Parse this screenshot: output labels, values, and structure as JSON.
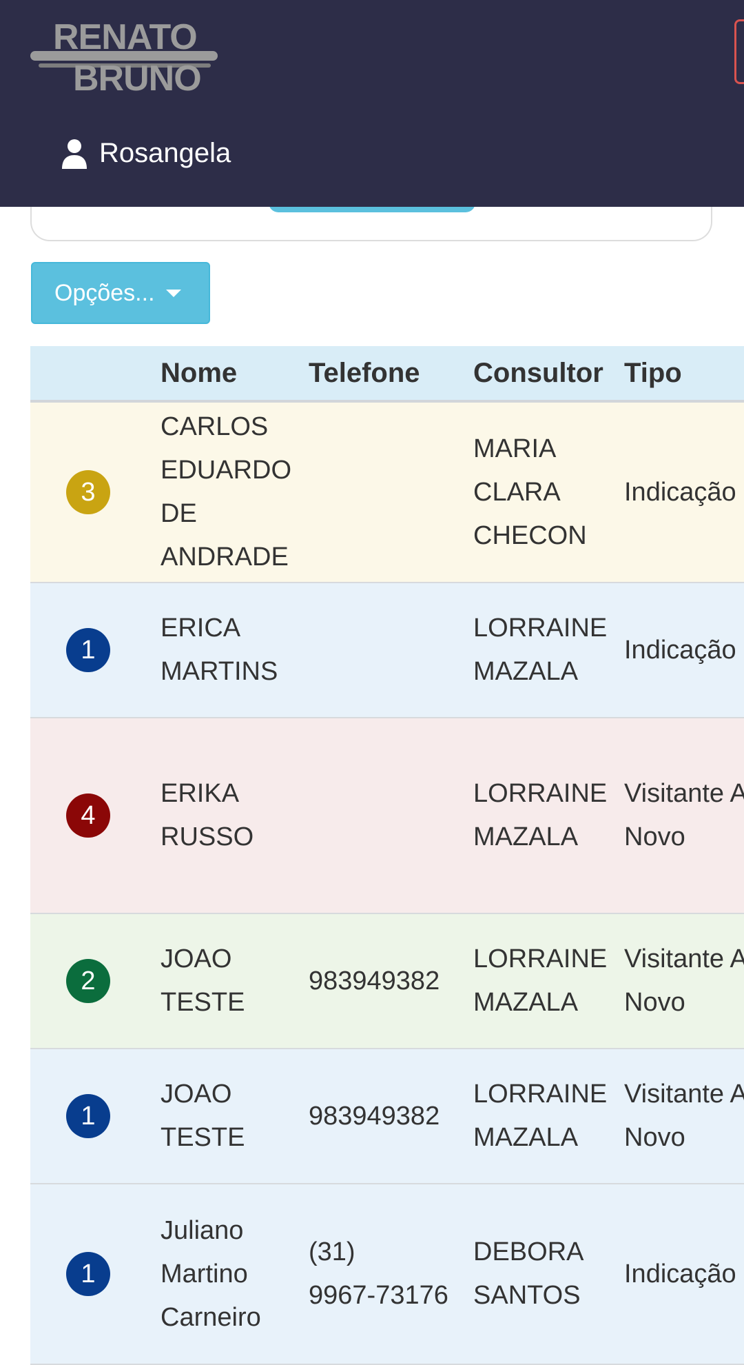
{
  "header": {
    "logo_line1": "RENATO",
    "logo_line2": "BRUNO",
    "user_name": "Rosangela",
    "bg_color": "#2d2d48"
  },
  "options_button": {
    "label": "Opções...",
    "color": "#5bc0de"
  },
  "table": {
    "columns": [
      "",
      "Nome",
      "Telefone",
      "Consultor",
      "Tipo"
    ],
    "rows": [
      {
        "badge": "3",
        "badge_color": "#c9a412",
        "row_color": "#fcf8e8",
        "nome": "CARLOS\nEDUARDO\nDE\nANDRADE",
        "telefone": "",
        "consultor": "MARIA\nCLARA\nCHECON",
        "tipo": "Indicação"
      },
      {
        "badge": "1",
        "badge_color": "#083d8e",
        "row_color": "#e8f2fa",
        "nome": "ERICA\nMARTINS",
        "telefone": "",
        "consultor": "LORRAINE\nMAZALA",
        "tipo": "Indicação"
      },
      {
        "badge": "4",
        "badge_color": "#8b0707",
        "row_color": "#f7ebeb",
        "nome": "ERIKA\nRUSSO",
        "telefone": "",
        "consultor": "LORRAINE\nMAZALA",
        "tipo": "Visitante A\nNovo"
      },
      {
        "badge": "2",
        "badge_color": "#0b6d3d",
        "row_color": "#edf5e8",
        "nome": "JOAO\nTESTE",
        "telefone": "983949382",
        "consultor": "LORRAINE\nMAZALA",
        "tipo": "Visitante A\nNovo"
      },
      {
        "badge": "1",
        "badge_color": "#083d8e",
        "row_color": "#e8f2fa",
        "nome": "JOAO\nTESTE",
        "telefone": "983949382",
        "consultor": "LORRAINE\nMAZALA",
        "tipo": "Visitante A\nNovo"
      },
      {
        "badge": "1",
        "badge_color": "#083d8e",
        "row_color": "#e8f2fa",
        "nome": "Juliano\nMartino\nCarneiro",
        "telefone": "(31)\n9967-73176",
        "consultor": "DEBORA\nSANTOS",
        "tipo": "Indicação"
      }
    ]
  }
}
